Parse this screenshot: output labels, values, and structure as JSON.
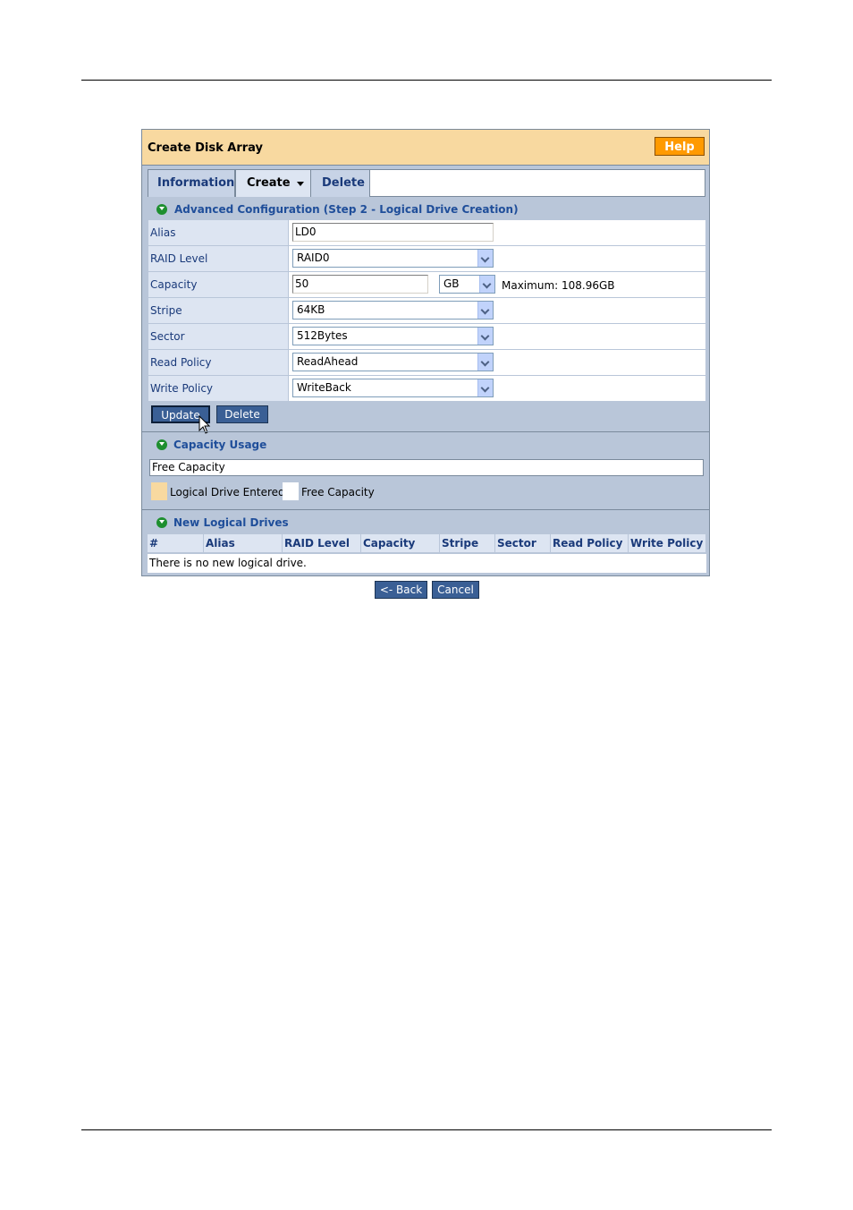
{
  "title": "Create Disk Array",
  "help_label": "Help",
  "tabs": [
    {
      "label": "Information"
    },
    {
      "label": "Create"
    },
    {
      "label": "Delete"
    }
  ],
  "advanced": {
    "heading": "Advanced Configuration (Step 2 - Logical Drive Creation)",
    "fields": {
      "alias": {
        "label": "Alias",
        "value": "LD0"
      },
      "raid_level": {
        "label": "RAID Level",
        "value": "RAID0"
      },
      "capacity": {
        "label": "Capacity",
        "value": "50",
        "unit": "GB",
        "max": "Maximum: 108.96GB"
      },
      "stripe": {
        "label": "Stripe",
        "value": "64KB"
      },
      "sector": {
        "label": "Sector",
        "value": "512Bytes"
      },
      "read_policy": {
        "label": "Read Policy",
        "value": "ReadAhead"
      },
      "write_policy": {
        "label": "Write Policy",
        "value": "WriteBack"
      }
    },
    "update_label": "Update",
    "delete_label": "Delete"
  },
  "capacity_usage": {
    "heading": "Capacity Usage",
    "bar_text": "Free Capacity",
    "legend": [
      {
        "label": "Logical Drive Entered",
        "color": "#f8d9a0"
      },
      {
        "label": "Free Capacity",
        "color": "#ffffff"
      }
    ]
  },
  "new_drives": {
    "heading": "New Logical Drives",
    "columns": [
      "#",
      "Alias",
      "RAID Level",
      "Capacity",
      "Stripe",
      "Sector",
      "Read Policy",
      "Write Policy"
    ],
    "empty_text": "There is no new logical drive."
  },
  "footer": {
    "back_label": "<- Back",
    "cancel_label": "Cancel"
  },
  "colors": {
    "title_bar": "#f8d9a0",
    "help_button": "#ff9a00",
    "panel_bg": "#b9c6d9",
    "button_bg": "#3a5f95",
    "section_icon": "#1e8f2f"
  }
}
